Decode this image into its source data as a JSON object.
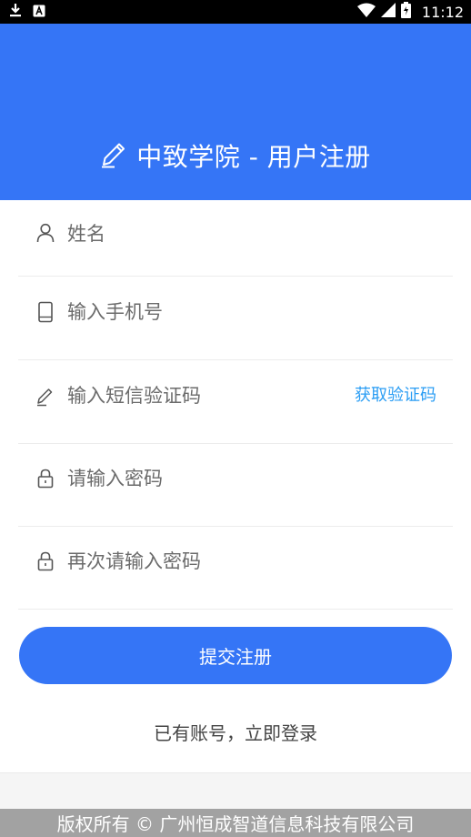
{
  "status_bar": {
    "time": "11:12",
    "icons": [
      "download-icon",
      "a-badge-icon",
      "wifi-icon",
      "cell-signal-icon",
      "battery-icon"
    ]
  },
  "header": {
    "title": "中致学院 - 用户注册",
    "icon": "pencil-icon"
  },
  "form": {
    "name_placeholder": "姓名",
    "phone_placeholder": "输入手机号",
    "sms_placeholder": "输入短信验证码",
    "get_code_label": "获取验证码",
    "password_placeholder": "请输入密码",
    "confirm_placeholder": "再次请输入密码"
  },
  "actions": {
    "submit_label": "提交注册",
    "login_link": "已有账号，立即登录"
  },
  "footer": {
    "copyright": "版权所有 © 广州恒成智道信息科技有限公司"
  },
  "colors": {
    "primary": "#3575f6",
    "link": "#2a9df4",
    "footer_bg": "#a2a2a2"
  }
}
